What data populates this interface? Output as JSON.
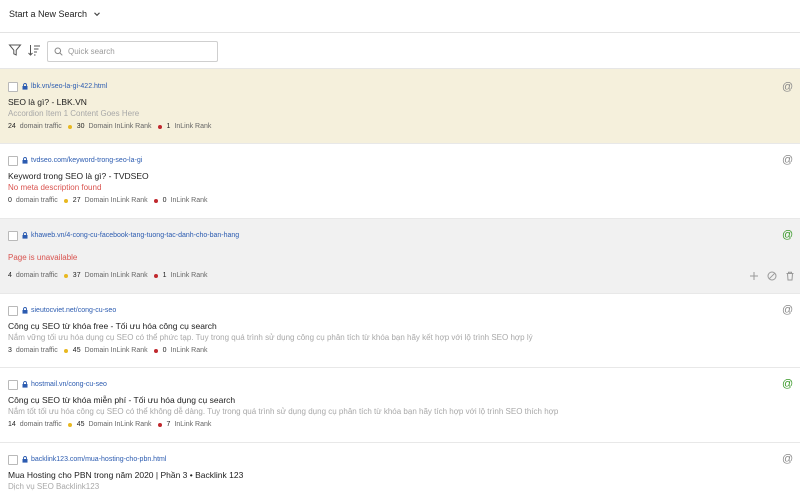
{
  "header": {
    "title": "Start a New Search"
  },
  "toolbar": {
    "search_placeholder": "Quick search"
  },
  "colors": {
    "yellow_dot": "#e8b820",
    "red_dot": "#c0282d",
    "green_at": "#3a9a2a",
    "gray_at": "#8a8a8a"
  },
  "metric_labels": {
    "traffic": "domain traffic",
    "domain_rank": "Domain InLink Rank",
    "inlink_rank": "InLink Rank"
  },
  "results": [
    {
      "url": "lbk.vn/seo-la-gi-422.html",
      "title": "SEO là gì? - LBK.VN",
      "description": "Accordion Item 1 Content Goes Here",
      "traffic": "24",
      "domain_rank": "30",
      "inlink_rank": "1",
      "at_icon": "at-gray-icon"
    },
    {
      "url": "tvdseo.com/keyword-trong-seo-la-gi",
      "title": "Keyword trong SEO là gì? - TVDSEO",
      "description": "No meta description found",
      "traffic": "0",
      "domain_rank": "27",
      "inlink_rank": "0",
      "at_icon": "at-gray-icon"
    },
    {
      "url": "khaweb.vn/4-cong-cu-facebook-tang-tuong-tac-danh-cho-ban-hang",
      "title": "",
      "description": "Page is unavailable",
      "traffic": "4",
      "domain_rank": "37",
      "inlink_rank": "1",
      "at_icon": "at-green-icon"
    },
    {
      "url": "sieutocviet.net/cong-cu-seo",
      "title": "Công cụ SEO từ khóa free - Tối ưu hóa công cụ search",
      "description": "Nắm vững tối ưu hóa dụng cụ SEO có thể phức tạp. Tuy trong quá trình sử dụng công cụ phân tích từ khóa bạn hãy kết hợp với lộ trình SEO hợp lý",
      "traffic": "3",
      "domain_rank": "45",
      "inlink_rank": "0",
      "at_icon": "at-gray-icon"
    },
    {
      "url": "hostmail.vn/cong-cu-seo",
      "title": "Công cụ SEO từ khóa miễn phí - Tối ưu hóa dụng cụ search",
      "description": "Nắm tốt tối ưu hóa công cụ SEO có thể không dễ dàng. Tuy trong quá trình sử dụng dụng cụ phân tích từ khóa bạn hãy tích hợp với lộ trình SEO thích hợp",
      "traffic": "14",
      "domain_rank": "45",
      "inlink_rank": "7",
      "at_icon": "at-green-icon"
    },
    {
      "url": "backlink123.com/mua-hosting-cho-pbn.html",
      "title": "Mua Hosting cho PBN trong năm 2020 | Phần 3 • Backlink 123",
      "description": "Dịch vụ SEO Backlink123",
      "traffic": "",
      "domain_rank": "",
      "inlink_rank": "",
      "at_icon": "at-gray-icon"
    }
  ]
}
